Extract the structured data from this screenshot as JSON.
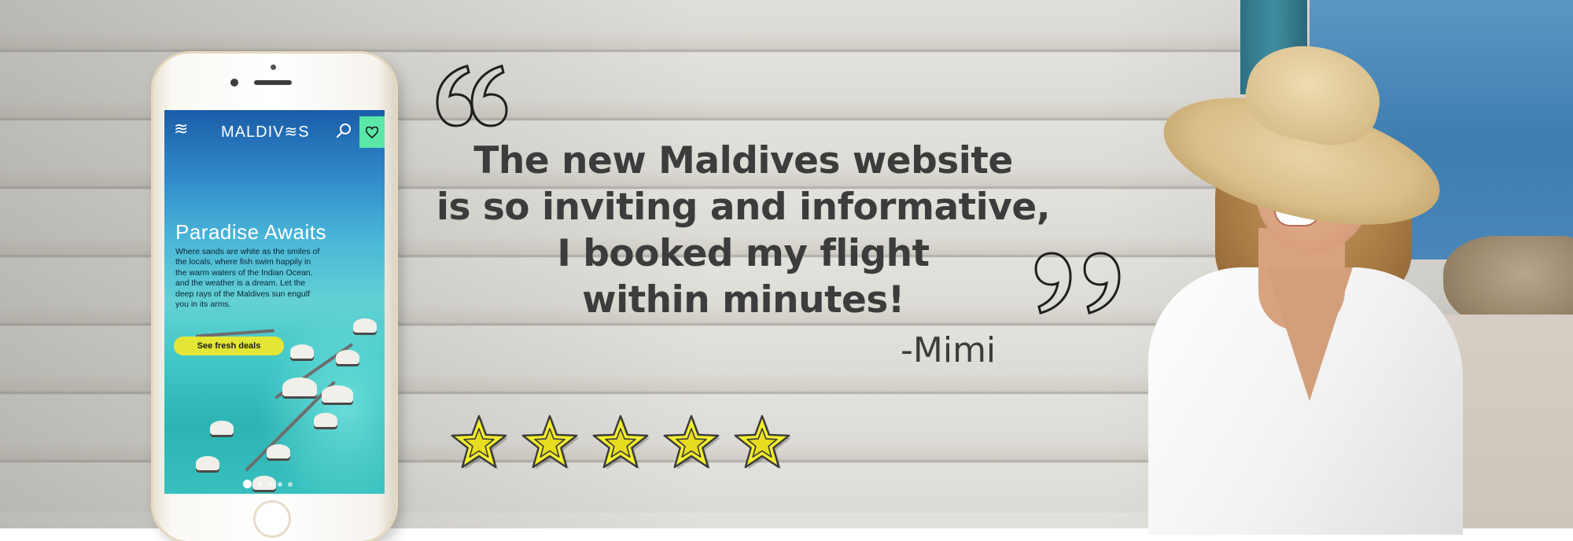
{
  "phone": {
    "nav": {
      "menu_icon": "menu-waves-icon",
      "logo": "MALDIV≋S",
      "search_icon": "search-icon",
      "favorite_icon": "heart-icon"
    },
    "hero": {
      "title": "Paradise Awaits",
      "body": "Where sands are white as the smiles of the locals, where fish swim happily in the warm waters of the Indian Ocean, and the weather is a dream. Let the deep rays of the Maldives sun engulf you in its arms.",
      "cta": "See fresh deals"
    },
    "carousel": {
      "count": 5,
      "active": 1
    }
  },
  "testimonial": {
    "lines": [
      "The new Maldives website",
      "is so inviting and informative,",
      "I booked my flight",
      "within minutes!"
    ],
    "author": "-Mimi",
    "rating": 5,
    "rating_max": 5
  },
  "colors": {
    "text": "#3c3c3c",
    "star_fill": "#f2ee2e",
    "cta": "#e4e636",
    "fav": "#5be7a8"
  }
}
